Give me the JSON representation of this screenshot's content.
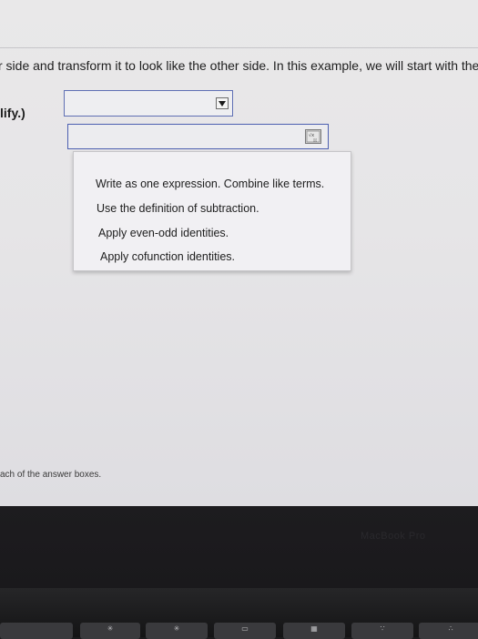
{
  "instruction_line": "r side and transform it to look like the other side. In this example, we will start with the ri",
  "simplify_label": "lify.)",
  "reason_dropdown": {
    "selected": "",
    "options": [
      "Write as one expression. Combine like terms.",
      "Use the definition of subtraction.",
      "Apply even-odd identities.",
      "Apply cofunction identities."
    ]
  },
  "answer_input": {
    "value": ""
  },
  "footer_note": "ach of the answer boxes.",
  "bezel_brand": "MacBook Pro",
  "icons": {
    "dropdown": "triangle-down-icon",
    "palette": "math-palette-icon"
  },
  "colors": {
    "field_border": "#5f6fb4",
    "menu_background": "#f1f0f3"
  }
}
